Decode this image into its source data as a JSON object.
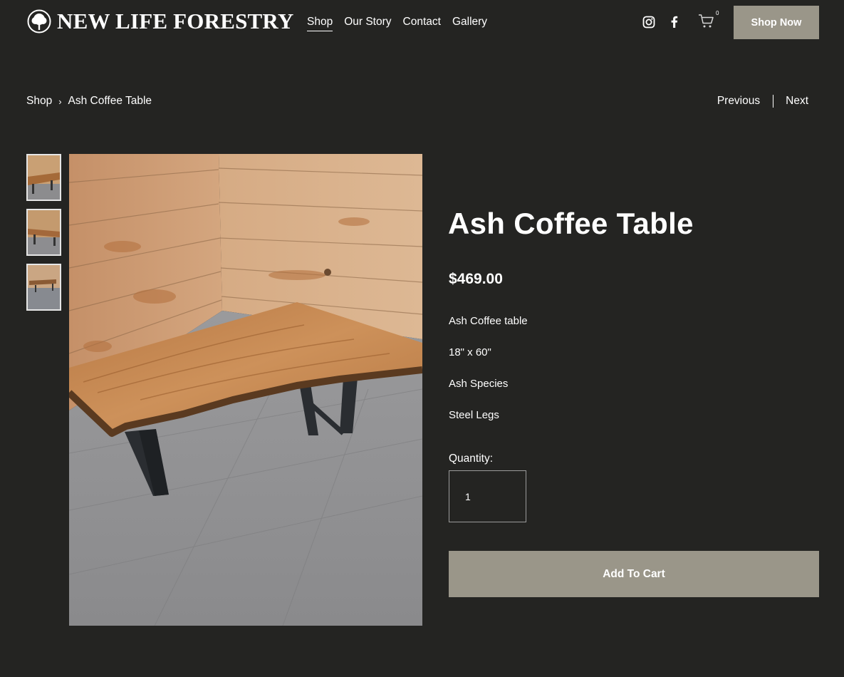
{
  "brand": {
    "name": "NEW LIFE FORESTRY",
    "icon": "tree-icon"
  },
  "nav": [
    {
      "label": "Shop",
      "active": true
    },
    {
      "label": "Our Story",
      "active": false
    },
    {
      "label": "Contact",
      "active": false
    },
    {
      "label": "Gallery",
      "active": false
    }
  ],
  "header": {
    "social_icons": [
      "instagram-icon",
      "facebook-icon"
    ],
    "cart_icon": "cart-icon",
    "cart_count": "0",
    "cta_label": "Shop Now",
    "cta_color": "#9a9689"
  },
  "breadcrumb": {
    "root": "Shop",
    "separator": "›",
    "current": "Ash Coffee Table"
  },
  "pager": {
    "previous": "Previous",
    "next": "Next"
  },
  "product": {
    "title": "Ash Coffee Table",
    "price": "$469.00",
    "description": [
      "Ash Coffee table",
      "18\" x 60\"",
      "Ash Species",
      "Steel Legs"
    ],
    "quantity_label": "Quantity:",
    "quantity_value": "1",
    "add_to_cart_label": "Add To Cart",
    "thumbnail_count": 3
  },
  "colors": {
    "background": "#242422",
    "button": "#9a9689",
    "text": "#ffffff"
  }
}
